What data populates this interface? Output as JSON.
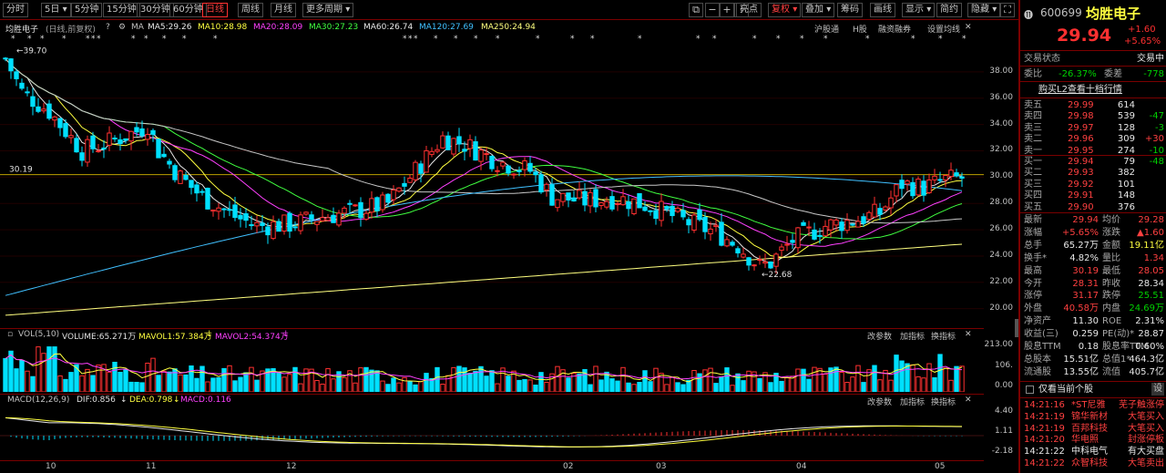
{
  "toolbar": {
    "periods": [
      "分时",
      "5日",
      "5分钟",
      "15分钟",
      "30分钟",
      "60分钟",
      "日线",
      "周线",
      "月线",
      "更多周期"
    ],
    "active_period": "日线",
    "tools": [
      "亮点",
      "复权",
      "叠加",
      "筹码",
      "画线",
      "显示",
      "简约",
      "隐藏"
    ],
    "period_dropdown_mark": "▾"
  },
  "main_info": {
    "stock_name": "均胜电子",
    "mode": "(日线,前复权)",
    "ma_label": "MA",
    "ma": [
      {
        "label": "MA5:29.26",
        "color": "#e8e8e8"
      },
      {
        "label": "MA10:28.98",
        "color": "#ffff40"
      },
      {
        "label": "MA20:28.09",
        "color": "#ff40ff"
      },
      {
        "label": "MA30:27.23",
        "color": "#40ff40"
      },
      {
        "label": "MA60:26.74",
        "color": "#e8e8e8"
      },
      {
        "label": "MA120:27.69",
        "color": "#40c0ff"
      },
      {
        "label": "MA250:24.94",
        "color": "#ffff80"
      }
    ],
    "right_links": [
      "沪股通",
      "H股",
      "融资融券",
      "设置均线"
    ]
  },
  "price_axis": [
    "38.00",
    "36.00",
    "34.00",
    "32.00",
    "30.00",
    "28.00",
    "26.00",
    "24.00",
    "22.00",
    "20.00"
  ],
  "annotations": {
    "high": "39.70",
    "low": "22.68",
    "current_line": "30.19"
  },
  "vol_panel": {
    "title": "VOL(5,10)",
    "volume": "VOLUME:65.271万",
    "mavol1": "MAVOL1:57.384万",
    "mavol2": "MAVOL2:54.374万",
    "links": [
      "改参数",
      "加指标",
      "换指标"
    ],
    "axis": [
      "213.00",
      "106.",
      "0.00"
    ]
  },
  "macd_panel": {
    "title": "MACD(12,26,9)",
    "dif": "DIF:0.856",
    "dea": "DEA:0.798",
    "macd": "MACD:0.116",
    "links": [
      "改参数",
      "加指标",
      "换指标"
    ],
    "axis": [
      "4.40",
      "1.11",
      "-2.18"
    ]
  },
  "x_axis": [
    "10",
    "11",
    "12",
    "02",
    "03",
    "04",
    "05"
  ],
  "sidebar": {
    "code": "600699",
    "name": "均胜电子",
    "price": "29.94",
    "change": "+1.60",
    "change_pct": "+5.65%",
    "trade_status_label": "交易状态",
    "trade_status_value": "交易中",
    "weibi_label": "委比",
    "weibi_value": "-26.37%",
    "weicha_label": "委差",
    "weicha_value": "-778",
    "l2_link": "购买L2查看十档行情",
    "asks": [
      {
        "label": "卖五",
        "price": "29.99",
        "vol": "614",
        "chg": ""
      },
      {
        "label": "卖四",
        "price": "29.98",
        "vol": "539",
        "chg": "-47"
      },
      {
        "label": "卖三",
        "price": "29.97",
        "vol": "128",
        "chg": "-3"
      },
      {
        "label": "卖二",
        "price": "29.96",
        "vol": "309",
        "chg": "+30"
      },
      {
        "label": "卖一",
        "price": "29.95",
        "vol": "274",
        "chg": "-10"
      }
    ],
    "bids": [
      {
        "label": "买一",
        "price": "29.94",
        "vol": "79",
        "chg": "-48"
      },
      {
        "label": "买二",
        "price": "29.93",
        "vol": "382",
        "chg": ""
      },
      {
        "label": "买三",
        "price": "29.92",
        "vol": "101",
        "chg": ""
      },
      {
        "label": "买四",
        "price": "29.91",
        "vol": "148",
        "chg": ""
      },
      {
        "label": "买五",
        "price": "29.90",
        "vol": "376",
        "chg": ""
      }
    ],
    "stats": [
      {
        "l1": "最新",
        "v1": "29.94",
        "c1": "red",
        "l2": "均价",
        "v2": "29.28",
        "c2": "red"
      },
      {
        "l1": "涨幅",
        "v1": "+5.65%",
        "c1": "red",
        "l2": "涨跌",
        "v2": "▲1.60",
        "c2": "red"
      },
      {
        "l1": "总手",
        "v1": "65.27万",
        "c1": "white",
        "l2": "金额",
        "v2": "19.11亿",
        "c2": "yellow"
      },
      {
        "l1": "换手*",
        "v1": "4.82%",
        "c1": "white",
        "l2": "量比",
        "v2": "1.34",
        "c2": "red"
      },
      {
        "l1": "最高",
        "v1": "30.19",
        "c1": "red",
        "l2": "最低",
        "v2": "28.05",
        "c2": "red"
      },
      {
        "l1": "今开",
        "v1": "28.31",
        "c1": "red",
        "l2": "昨收",
        "v2": "28.34",
        "c2": "white"
      },
      {
        "l1": "涨停",
        "v1": "31.17",
        "c1": "red",
        "l2": "跌停",
        "v2": "25.51",
        "c2": "green"
      },
      {
        "l1": "外盘",
        "v1": "40.58万",
        "c1": "red",
        "l2": "内盘",
        "v2": "24.69万",
        "c2": "green"
      },
      {
        "l1": "净资产",
        "v1": "11.30",
        "c1": "white",
        "l2": "ROE",
        "v2": "2.31%",
        "c2": "white"
      },
      {
        "l1": "收益(三)",
        "v1": "0.259",
        "c1": "white",
        "l2": "PE(动)*",
        "v2": "28.87",
        "c2": "white"
      },
      {
        "l1": "股息TTM",
        "v1": "0.18",
        "c1": "white",
        "l2": "股息率TTM",
        "v2": "0.60%",
        "c2": "white"
      },
      {
        "l1": "总股本",
        "v1": "15.51亿",
        "c1": "white",
        "l2": "总值1*",
        "v2": "464.3亿",
        "c2": "white"
      },
      {
        "l1": "流通股",
        "v1": "13.55亿",
        "c1": "white",
        "l2": "流值",
        "v2": "405.7亿",
        "c2": "white"
      }
    ],
    "filter_label": "仅看当前个股",
    "settings_label": "设",
    "ticks": [
      {
        "time": "14:21:16",
        "name": "*ST尼雅",
        "event": "芜子触涨停"
      },
      {
        "time": "14:21:19",
        "name": "锦华新材",
        "event": "大笔买入"
      },
      {
        "time": "14:21:19",
        "name": "百邦科技",
        "event": "大笔买入"
      },
      {
        "time": "14:21:20",
        "name": "华电照",
        "event": "封涨停板"
      },
      {
        "time": "14:21:22",
        "name": "中科电气",
        "event": "有大买盘"
      },
      {
        "time": "14:21:22",
        "name": "众智科技",
        "event": "大笔卖出"
      }
    ]
  },
  "colors": {
    "up": "#ff3030",
    "down": "#00e0ff",
    "border": "#7a0000",
    "bg": "#000000"
  }
}
